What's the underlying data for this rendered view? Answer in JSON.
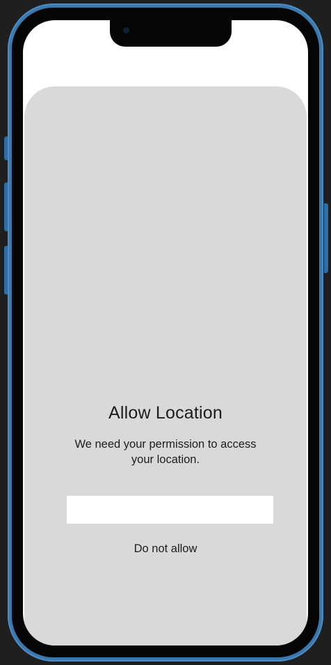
{
  "permission_sheet": {
    "title": "Allow Location",
    "message": "We need your permission to access your location.",
    "allow_button_label": "",
    "deny_button_label": "Do not allow"
  },
  "colors": {
    "device_frame": "#3a78ad",
    "background": "#1f1f1f",
    "sheet": "#d9d9d9",
    "screen": "#ffffff"
  }
}
